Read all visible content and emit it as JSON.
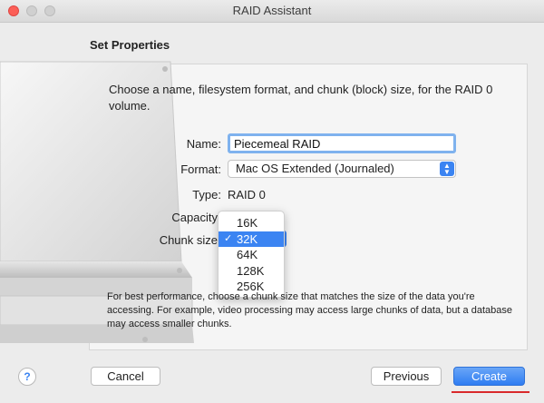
{
  "window": {
    "title": "RAID Assistant"
  },
  "page": {
    "heading": "Set Properties",
    "description": "Choose a name, filesystem format, and chunk (block) size, for the RAID 0 volume."
  },
  "form": {
    "name_label": "Name:",
    "name_value": "Piecemeal RAID",
    "format_label": "Format:",
    "format_value": "Mac OS Extended (Journaled)",
    "type_label": "Type:",
    "type_value": "RAID 0",
    "capacity_label": "Capacity",
    "chunk_label": "Chunk size"
  },
  "chunk_menu": {
    "options": [
      "16K",
      "32K",
      "64K",
      "128K",
      "256K"
    ],
    "selected": "32K",
    "check_glyph": "✓"
  },
  "note": "For best performance, choose a chunk size that matches the size of the data you're accessing. For example, video processing may access large chunks of data, but a database may access smaller chunks.",
  "buttons": {
    "help": "?",
    "cancel": "Cancel",
    "previous": "Previous",
    "create": "Create"
  },
  "colors": {
    "accent": "#3b84f2",
    "annotation_underline": "#d9292b"
  },
  "icons": {
    "drive": "hard-drive-icon",
    "help": "help-icon",
    "select_arrows": "chevron-updown-icon"
  }
}
